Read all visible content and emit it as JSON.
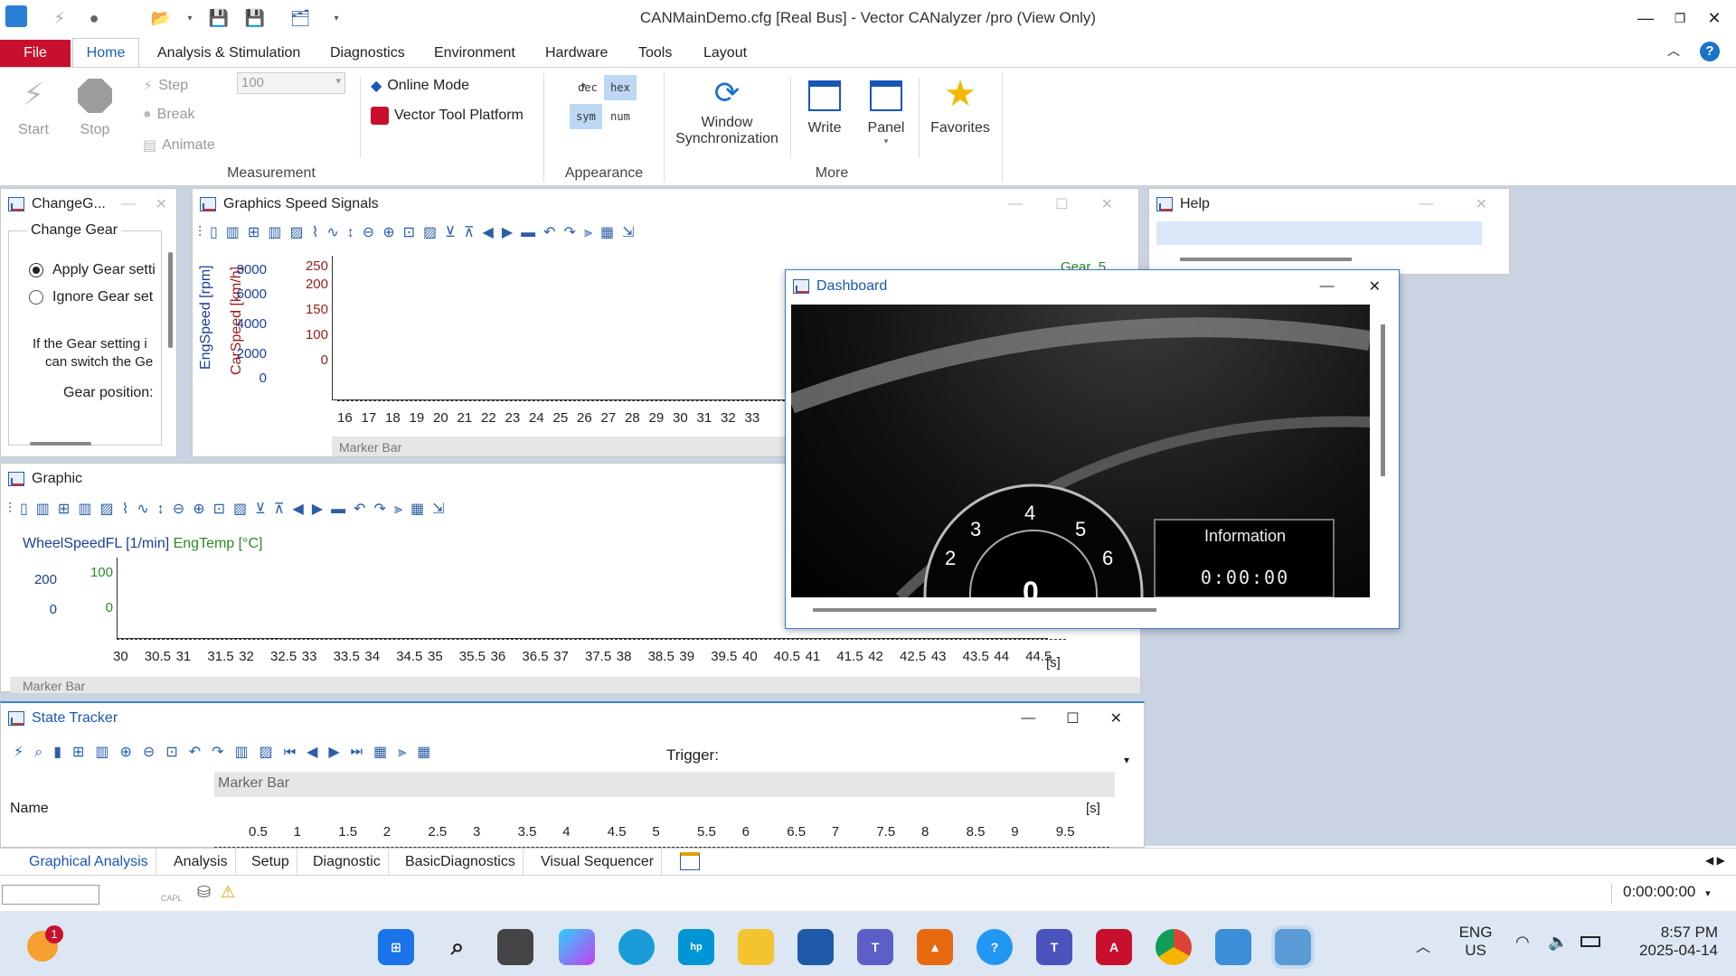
{
  "window": {
    "title": "CANMainDemo.cfg [Real Bus] - Vector CANalyzer /pro (View Only)"
  },
  "menu": {
    "file": "File",
    "home": "Home",
    "items": [
      "Analysis & Stimulation",
      "Diagnostics",
      "Environment",
      "Hardware",
      "Tools",
      "Layout"
    ]
  },
  "ribbon": {
    "start": "Start",
    "stop": "Stop",
    "step": "Step",
    "break": "Break",
    "animate": "Animate",
    "step_value": "100",
    "online_mode": "Online Mode",
    "vector_tool_platform": "Vector Tool Platform",
    "measurement_group": "Measurement",
    "dec": "dec",
    "hex": "hex",
    "sym": "sym",
    "num": "num",
    "appearance_group": "Appearance",
    "window_sync_line1": "Window",
    "window_sync_line2": "Synchronization",
    "write": "Write",
    "panel": "Panel",
    "favorites": "Favorites",
    "more_group": "More"
  },
  "change_gear": {
    "title": "ChangeG...",
    "group": "Change Gear",
    "apply": "Apply Gear setti",
    "ignore": "Ignore Gear set",
    "desc1": "If the Gear setting i",
    "desc2": "can switch the Ge",
    "position": "Gear position:"
  },
  "speed_signals": {
    "title": "Graphics Speed Signals",
    "y1_label": "EngSpeed [rpm]",
    "y2_label": "CarSpeed [km/h]",
    "y1_ticks": [
      "8000",
      "6000",
      "4000",
      "2000",
      "0"
    ],
    "y2_ticks": [
      "250",
      "200",
      "150",
      "100",
      "0"
    ],
    "x_ticks": [
      "16",
      "17",
      "18",
      "19",
      "20",
      "21",
      "22",
      "23",
      "24",
      "25",
      "26",
      "27",
      "28",
      "29",
      "30",
      "31",
      "32",
      "33"
    ],
    "gear_label": "Gear_5",
    "marker_bar": "Marker Bar"
  },
  "help": {
    "title": "Help"
  },
  "dashboard": {
    "title": "Dashboard",
    "info_label": "Information",
    "info_value": "0:00:00",
    "speed_value": "0",
    "gauge_numbers": [
      "2",
      "3",
      "4",
      "5",
      "6"
    ]
  },
  "graphic": {
    "title": "Graphic",
    "legend1": "WheelSpeedFL [1/min]",
    "legend2": "EngTemp [°C]",
    "y1_ticks": [
      "200",
      "0"
    ],
    "y2_ticks": [
      "100",
      "0"
    ],
    "x_ticks": [
      "30",
      "30.5",
      "31",
      "31.5",
      "32",
      "32.5",
      "33",
      "33.5",
      "34",
      "34.5",
      "35",
      "35.5",
      "36",
      "36.5",
      "37",
      "37.5",
      "38",
      "38.5",
      "39",
      "39.5",
      "40",
      "40.5",
      "41",
      "41.5",
      "42",
      "42.5",
      "43",
      "43.5",
      "44",
      "44.5"
    ],
    "unit": "[s]",
    "marker_bar": "Marker Bar"
  },
  "state_tracker": {
    "title": "State Tracker",
    "trigger": "Trigger:",
    "name_col": "Name",
    "marker_bar": "Marker Bar",
    "unit": "[s]",
    "x_ticks": [
      "0.5",
      "1",
      "1.5",
      "2",
      "2.5",
      "3",
      "3.5",
      "4",
      "4.5",
      "5",
      "5.5",
      "6",
      "6.5",
      "7",
      "7.5",
      "8",
      "8.5",
      "9",
      "9.5"
    ]
  },
  "bottom_tabs": [
    "Graphical Analysis",
    "Analysis",
    "Setup",
    "Diagnostic",
    "BasicDiagnostics",
    "Visual Sequencer"
  ],
  "status": {
    "capl": "CAPL",
    "time": "0:00:00:00"
  },
  "taskbar": {
    "lang1": "ENG",
    "lang2": "US",
    "clock_time": "8:57 PM",
    "clock_date": "2025-04-14",
    "badge_count": "1"
  }
}
